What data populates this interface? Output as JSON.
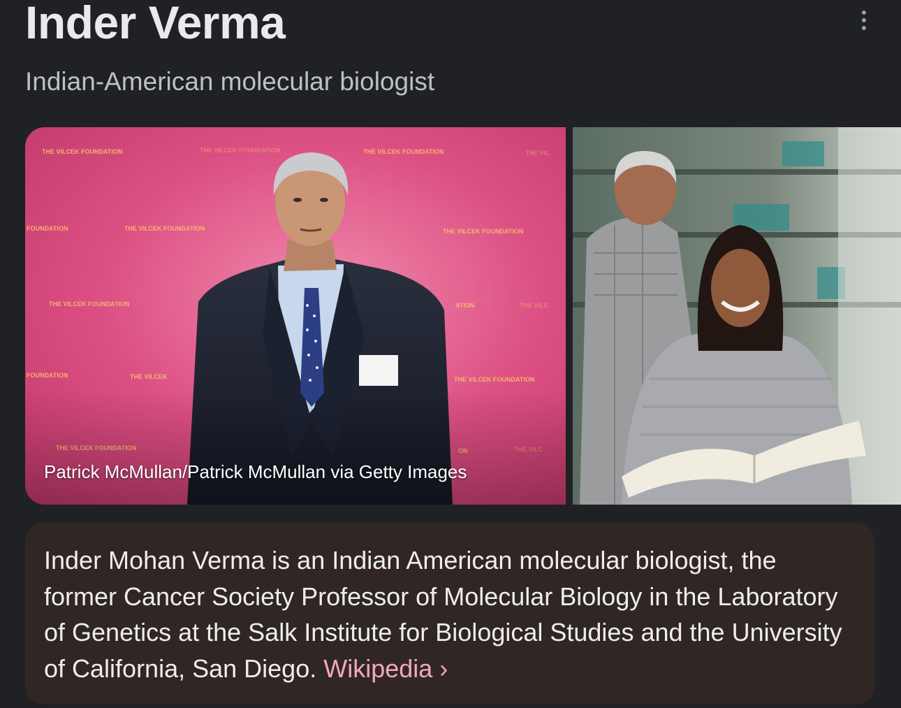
{
  "header": {
    "title": "Inder Verma",
    "subtitle": "Indian-American molecular biologist",
    "menu_icon": "more-vert-icon"
  },
  "images": {
    "main": {
      "caption": "Patrick McMullan/Patrick McMullan via Getty Images",
      "backdrop_text": "THE VILCEK FOUNDATION",
      "backdrop_color": "#d8447a"
    },
    "second": {
      "backdrop_color": "#6f7a6e"
    }
  },
  "description": {
    "text": "Inder Mohan Verma is an Indian American molecular biologist, the former Cancer Society Professor of Molecular Biology in the Laboratory of Genetics at the Salk Institute for Biological Studies and the University of California, San Diego. ",
    "link_label": "Wikipedia",
    "chevron": "›"
  },
  "colors": {
    "background": "#202124",
    "card": "#302725",
    "link": "#f4a6bf"
  }
}
